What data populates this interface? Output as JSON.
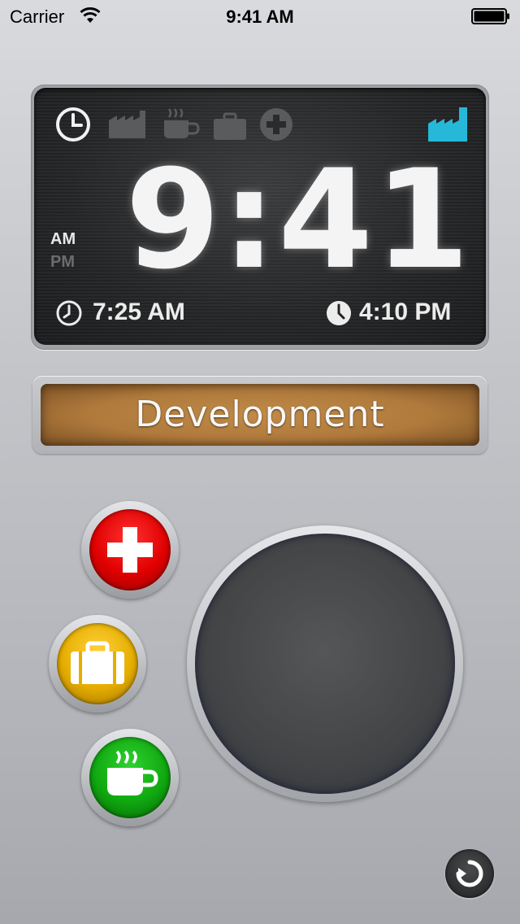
{
  "status_bar": {
    "carrier": "Carrier",
    "time": "9:41 AM"
  },
  "clock": {
    "time": "9:41",
    "am_label": "AM",
    "pm_label": "PM",
    "active_period": "AM",
    "start_time": "7:25 AM",
    "end_time": "4:10 PM",
    "mode_icons": [
      {
        "name": "clock-icon",
        "state": "active"
      },
      {
        "name": "factory-icon",
        "state": "inactive"
      },
      {
        "name": "coffee-icon",
        "state": "inactive"
      },
      {
        "name": "briefcase-icon",
        "state": "inactive"
      },
      {
        "name": "medical-cross-icon",
        "state": "inactive"
      },
      {
        "name": "factory-icon",
        "state": "highlighted"
      }
    ],
    "highlight_color": "#26b8d9"
  },
  "project": {
    "label": "Development"
  },
  "buttons": {
    "sick": {
      "icon": "medical-cross-icon",
      "color": "#e00000"
    },
    "work": {
      "icon": "briefcase-icon",
      "color": "#e5ad00"
    },
    "break": {
      "icon": "coffee-icon",
      "color": "#10a810"
    },
    "main": {
      "icon": "none",
      "color": "#434446"
    },
    "refresh": {
      "icon": "refresh-icon"
    }
  }
}
